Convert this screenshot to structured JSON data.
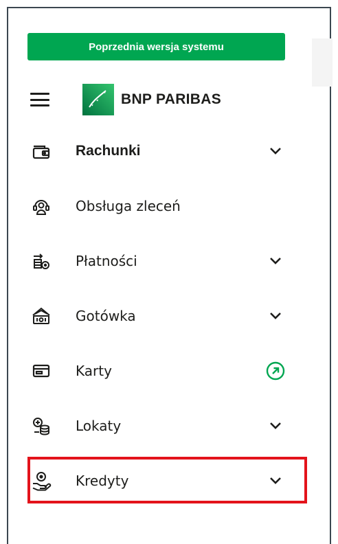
{
  "banner": {
    "prev_version_label": "Poprzednia wersja systemu"
  },
  "header": {
    "brand_name": "BNP PARIBAS",
    "menu_icon": "hamburger-icon"
  },
  "colors": {
    "accent_green": "#00a651",
    "highlight_red": "#e3131b",
    "text": "#1d1d1b"
  },
  "menu": {
    "items": [
      {
        "label": "Rachunki",
        "icon": "wallet-icon",
        "right": "chevron-down-icon",
        "bold": true
      },
      {
        "label": "Obsługa zleceń",
        "icon": "service-agent-icon",
        "right": ""
      },
      {
        "label": "Płatności",
        "icon": "payments-icon",
        "right": "chevron-down-icon"
      },
      {
        "label": "Gotówka",
        "icon": "cash-icon",
        "right": "chevron-down-icon"
      },
      {
        "label": "Karty",
        "icon": "card-icon",
        "right": "external-link-icon"
      },
      {
        "label": "Lokaty",
        "icon": "deposit-icon",
        "right": "chevron-down-icon"
      },
      {
        "label": "Kredyty",
        "icon": "loan-icon",
        "right": "chevron-down-icon",
        "highlighted": true
      }
    ]
  }
}
